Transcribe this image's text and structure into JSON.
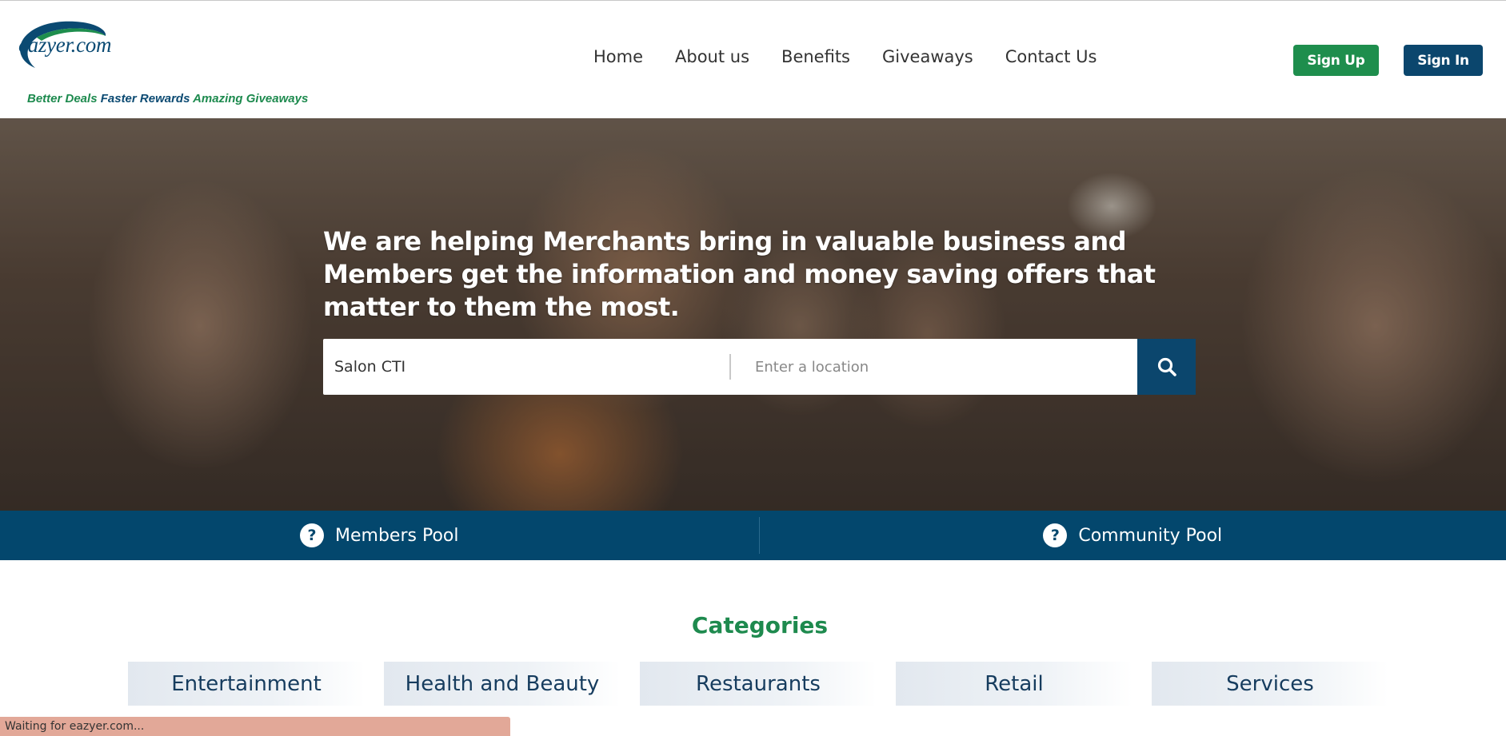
{
  "brand": {
    "logo_text": "eazyer.com",
    "tagline": [
      "Better Deals",
      "Faster Rewards",
      "Amazing Giveaways"
    ]
  },
  "nav": {
    "items": [
      "Home",
      "About us",
      "Benefits",
      "Giveaways",
      "Contact Us"
    ]
  },
  "auth": {
    "signup_label": "Sign Up",
    "signin_label": "Sign In"
  },
  "hero": {
    "title": "We are helping Merchants bring in valuable business and Members get the information and money saving offers that matter to them the most.",
    "search_value": "Salon CTI",
    "location_placeholder": "Enter a location",
    "search_icon": "search-icon"
  },
  "pools": {
    "members_label": "Members Pool",
    "community_label": "Community Pool",
    "help_icon": "question-circle-icon"
  },
  "categories": {
    "heading": "Categories",
    "items": [
      "Entertainment",
      "Health and Beauty",
      "Restaurants",
      "Retail",
      "Services"
    ]
  },
  "status_bar": {
    "text": "Waiting for eazyer.com..."
  },
  "colors": {
    "brand_green": "#1e8e4d",
    "brand_navy": "#0b466d",
    "pool_bar": "#03476d",
    "heading_green": "#1e8a4e"
  }
}
